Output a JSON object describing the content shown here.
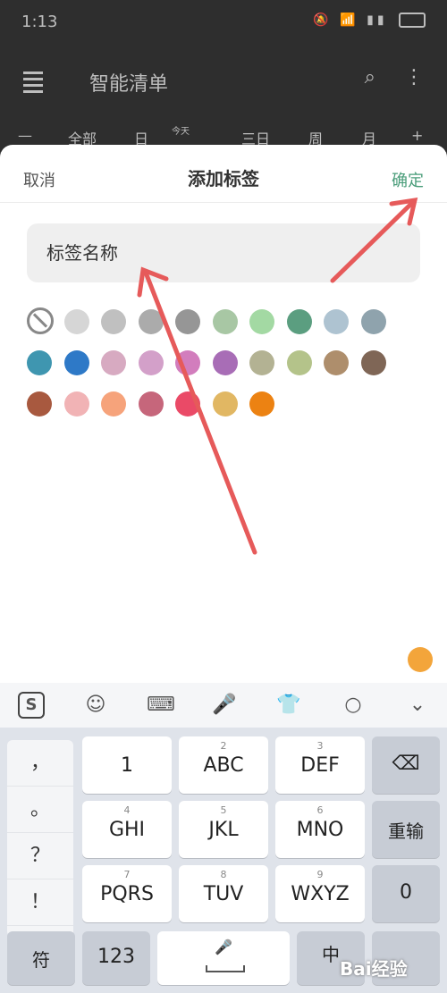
{
  "status": {
    "time": "1:13"
  },
  "appbar": {
    "title": "智能清单"
  },
  "tabs": [
    "全部",
    "日",
    "今天",
    "三日",
    "周",
    "月"
  ],
  "sheet": {
    "cancel": "取消",
    "title": "添加标签",
    "confirm": "确定",
    "placeholder": "标签名称"
  },
  "colors": [
    "#d6d6d6",
    "#c0c0c0",
    "#ababab",
    "#969696",
    "#a8c7a4",
    "#a3d9a3",
    "#5b9e80",
    "#aec3d1",
    "#8fa3ad",
    "#3f96b0",
    "#2e79c7",
    "#d7aac1",
    "#d3a0c9",
    "#d27dbd",
    "#a86db6",
    "#b3b293",
    "#b4c38a",
    "#ae8e6c",
    "#7f6656",
    "#a8593f",
    "#f1b3b5",
    "#f6a37b",
    "#c6667b",
    "#ea4a67",
    "#e1b763",
    "#ec8212"
  ],
  "keyboard": {
    "left": [
      "，",
      "。",
      "？",
      "！"
    ],
    "keys": [
      {
        "sub": "",
        "main": "1"
      },
      {
        "sub": "2",
        "main": "ABC"
      },
      {
        "sub": "3",
        "main": "DEF"
      },
      {
        "sub": "4",
        "main": "GHI"
      },
      {
        "sub": "5",
        "main": "JKL"
      },
      {
        "sub": "6",
        "main": "MNO"
      },
      {
        "sub": "7",
        "main": "PQRS"
      },
      {
        "sub": "8",
        "main": "TUV"
      },
      {
        "sub": "9",
        "main": "WXYZ"
      }
    ],
    "reenter": "重输",
    "zero": "0",
    "symbols": "符",
    "numbers": "123",
    "zh": "中",
    "watermark": "Bai经验"
  }
}
